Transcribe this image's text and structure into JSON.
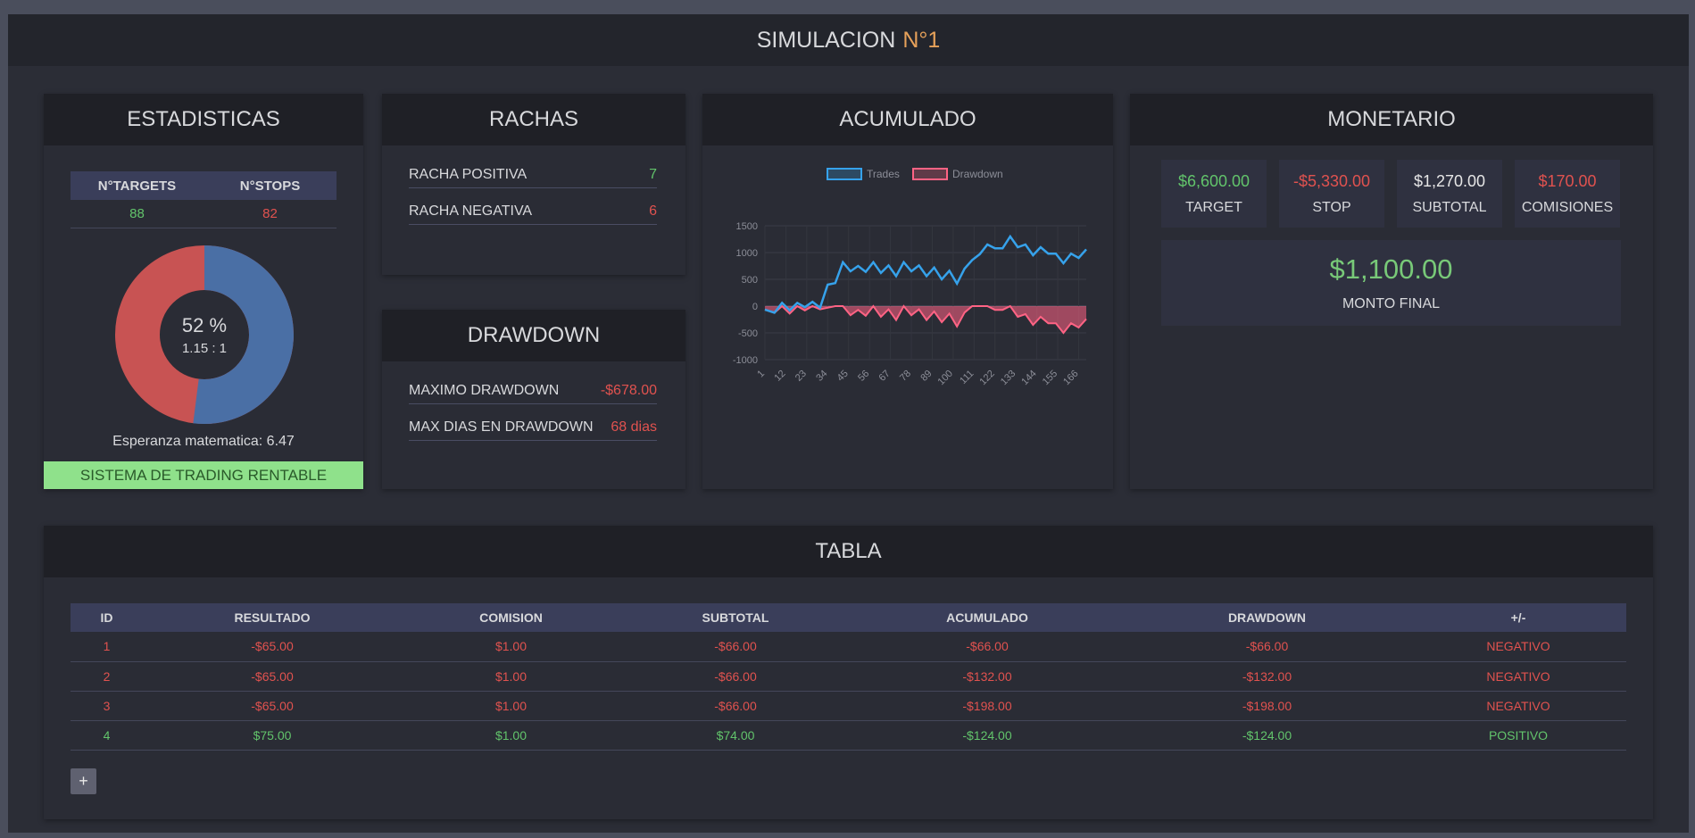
{
  "header": {
    "title": "SIMULACION",
    "title_accent": "N°1"
  },
  "estadisticas": {
    "title": "ESTADISTICAS",
    "targets_label": "N°TARGETS",
    "stops_label": "N°STOPS",
    "targets_value": "88",
    "stops_value": "82",
    "win_percent": 52,
    "pct_label": "52 %",
    "ratio_label": "1.15 : 1",
    "esperanza": "Esperanza matematica: 6.47",
    "status": "SISTEMA DE TRADING RENTABLE",
    "colors": {
      "win": "#4a6fa5",
      "loss": "#c85353"
    }
  },
  "rachas": {
    "title": "RACHAS",
    "positiva_label": "RACHA POSITIVA",
    "positiva_value": "7",
    "negativa_label": "RACHA NEGATIVA",
    "negativa_value": "6"
  },
  "drawdown": {
    "title": "DRAWDOWN",
    "maximo_label": "MAXIMO DRAWDOWN",
    "maximo_value": "-$678.00",
    "dias_label": "MAX DIAS EN DRAWDOWN",
    "dias_value": "68 dias"
  },
  "acumulado": {
    "title": "ACUMULADO"
  },
  "chart_data": {
    "type": "line",
    "legend": [
      "Trades",
      "Drawdown"
    ],
    "legend_position": "top",
    "ylim": [
      -1000,
      1500
    ],
    "yticks": [
      1500,
      1000,
      500,
      0,
      -500,
      -1000
    ],
    "xticks": [
      "1",
      "12",
      "23",
      "34",
      "45",
      "56",
      "67",
      "78",
      "89",
      "100",
      "111",
      "122",
      "133",
      "144",
      "155",
      "166"
    ],
    "grid": true,
    "colors": {
      "trades": "#36a2eb",
      "drawdown": "#ff6384"
    },
    "series": [
      {
        "name": "Trades",
        "x": [
          1,
          6,
          10,
          14,
          18,
          22,
          26,
          30,
          34,
          38,
          42,
          46,
          50,
          54,
          58,
          62,
          66,
          70,
          74,
          78,
          82,
          86,
          90,
          94,
          98,
          102,
          106,
          110,
          114,
          118,
          122,
          126,
          130,
          134,
          138,
          142,
          146,
          150,
          154,
          158,
          162,
          166,
          170
        ],
        "values": [
          -66,
          -124,
          60,
          -80,
          60,
          -20,
          80,
          -30,
          400,
          430,
          820,
          650,
          750,
          640,
          820,
          620,
          760,
          560,
          820,
          650,
          760,
          560,
          720,
          500,
          660,
          420,
          700,
          860,
          970,
          1150,
          1080,
          1080,
          1300,
          1100,
          1150,
          950,
          1100,
          980,
          980,
          800,
          980,
          900,
          1060
        ]
      },
      {
        "name": "Drawdown",
        "x": [
          1,
          6,
          10,
          14,
          18,
          22,
          26,
          30,
          34,
          38,
          42,
          46,
          50,
          54,
          58,
          62,
          66,
          70,
          74,
          78,
          82,
          86,
          90,
          94,
          98,
          102,
          106,
          110,
          114,
          118,
          122,
          126,
          130,
          134,
          138,
          142,
          146,
          150,
          154,
          158,
          162,
          166,
          170
        ],
        "values": [
          -66,
          -124,
          0,
          -140,
          0,
          -80,
          0,
          -60,
          -30,
          0,
          0,
          -170,
          -70,
          -180,
          0,
          -200,
          -60,
          -260,
          0,
          -170,
          -60,
          -260,
          -100,
          -300,
          -140,
          -380,
          -120,
          0,
          0,
          0,
          -70,
          -70,
          0,
          -200,
          -150,
          -350,
          -200,
          -320,
          -320,
          -500,
          -320,
          -400,
          -240
        ]
      }
    ]
  },
  "monetario": {
    "title": "MONETARIO",
    "target_value": "$6,600.00",
    "target_label": "TARGET",
    "stop_value": "-$5,330.00",
    "stop_label": "STOP",
    "subtotal_value": "$1,270.00",
    "subtotal_label": "SUBTOTAL",
    "comisiones_value": "$170.00",
    "comisiones_label": "COMISIONES",
    "final_value": "$1,100.00",
    "final_label": "MONTO FINAL"
  },
  "tabla": {
    "title": "TABLA",
    "columns": [
      "ID",
      "RESULTADO",
      "COMISION",
      "SUBTOTAL",
      "ACUMULADO",
      "DRAWDOWN",
      "+/-"
    ],
    "rows": [
      [
        "1",
        "-$65.00",
        "$1.00",
        "-$66.00",
        "-$66.00",
        "-$66.00",
        "NEGATIVO"
      ],
      [
        "2",
        "-$65.00",
        "$1.00",
        "-$66.00",
        "-$132.00",
        "-$132.00",
        "NEGATIVO"
      ],
      [
        "3",
        "-$65.00",
        "$1.00",
        "-$66.00",
        "-$198.00",
        "-$198.00",
        "NEGATIVO"
      ],
      [
        "4",
        "$75.00",
        "$1.00",
        "$74.00",
        "-$124.00",
        "-$124.00",
        "POSITIVO"
      ]
    ],
    "add_label": "+"
  }
}
